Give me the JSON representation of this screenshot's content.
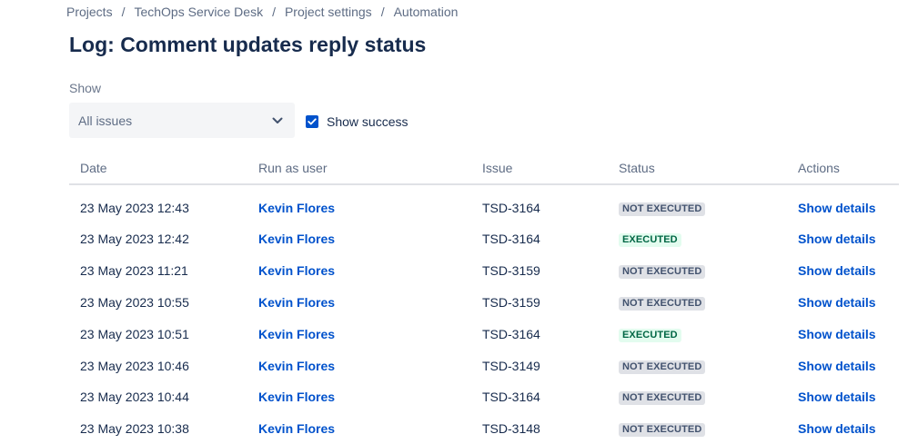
{
  "breadcrumb": [
    {
      "label": "Projects"
    },
    {
      "label": "TechOps Service Desk"
    },
    {
      "label": "Project settings"
    },
    {
      "label": "Automation"
    }
  ],
  "breadcrumb_separator": "/",
  "title": "Log: Comment updates reply status",
  "filter": {
    "label": "Show",
    "selected": "All issues",
    "show_success_label": "Show success",
    "show_success_checked": true
  },
  "table": {
    "headers": {
      "date": "Date",
      "user": "Run as user",
      "issue": "Issue",
      "status": "Status",
      "actions": "Actions"
    },
    "rows": [
      {
        "date": "23 May 2023 12:43",
        "user": "Kevin Flores",
        "issue": "TSD-3164",
        "status": "NOT EXECUTED",
        "status_type": "not-executed",
        "action": "Show details"
      },
      {
        "date": "23 May 2023 12:42",
        "user": "Kevin Flores",
        "issue": "TSD-3164",
        "status": "EXECUTED",
        "status_type": "executed",
        "action": "Show details"
      },
      {
        "date": "23 May 2023 11:21",
        "user": "Kevin Flores",
        "issue": "TSD-3159",
        "status": "NOT EXECUTED",
        "status_type": "not-executed",
        "action": "Show details"
      },
      {
        "date": "23 May 2023 10:55",
        "user": "Kevin Flores",
        "issue": "TSD-3159",
        "status": "NOT EXECUTED",
        "status_type": "not-executed",
        "action": "Show details"
      },
      {
        "date": "23 May 2023 10:51",
        "user": "Kevin Flores",
        "issue": "TSD-3164",
        "status": "EXECUTED",
        "status_type": "executed",
        "action": "Show details"
      },
      {
        "date": "23 May 2023 10:46",
        "user": "Kevin Flores",
        "issue": "TSD-3149",
        "status": "NOT EXECUTED",
        "status_type": "not-executed",
        "action": "Show details"
      },
      {
        "date": "23 May 2023 10:44",
        "user": "Kevin Flores",
        "issue": "TSD-3164",
        "status": "NOT EXECUTED",
        "status_type": "not-executed",
        "action": "Show details"
      },
      {
        "date": "23 May 2023 10:38",
        "user": "Kevin Flores",
        "issue": "TSD-3148",
        "status": "NOT EXECUTED",
        "status_type": "not-executed",
        "action": "Show details"
      }
    ]
  },
  "colors": {
    "link": "#0052cc",
    "text": "#172b4d",
    "muted": "#5e6c84",
    "executed_bg": "#e3fcef",
    "executed_text": "#006644",
    "not_executed_bg": "#dfe1e6",
    "not_executed_text": "#42526e"
  },
  "icons": {
    "dropdown": "chevron-down-icon",
    "checkbox": "checkmark-icon"
  }
}
